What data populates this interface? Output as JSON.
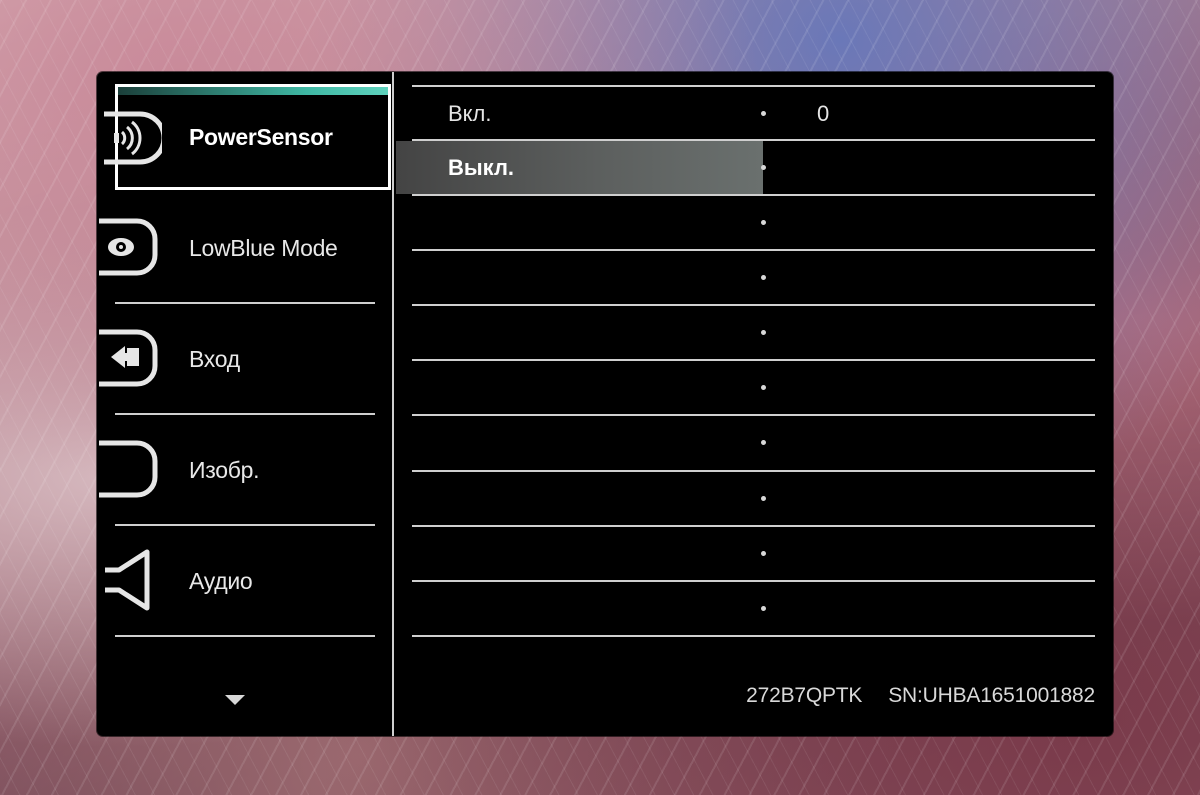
{
  "sidebar": {
    "items": [
      {
        "label": "PowerSensor",
        "icon": "power-sensor-icon",
        "selected": true
      },
      {
        "label": "LowBlue Mode",
        "icon": "eye-icon",
        "selected": false
      },
      {
        "label": "Вход",
        "icon": "input-icon",
        "selected": false
      },
      {
        "label": "Изобр.",
        "icon": "picture-icon",
        "selected": false
      },
      {
        "label": "Аудио",
        "icon": "speaker-icon",
        "selected": false
      }
    ],
    "more_icon": "chevron-down-icon"
  },
  "options": {
    "rows": [
      {
        "label": "Вкл.",
        "value": "0",
        "selected": false
      },
      {
        "label": "Выкл.",
        "value": "",
        "selected": true
      },
      {
        "label": "",
        "value": ""
      },
      {
        "label": "",
        "value": ""
      },
      {
        "label": "",
        "value": ""
      },
      {
        "label": "",
        "value": ""
      },
      {
        "label": "",
        "value": ""
      },
      {
        "label": "",
        "value": ""
      },
      {
        "label": "",
        "value": ""
      },
      {
        "label": "",
        "value": ""
      }
    ]
  },
  "footer": {
    "model": "272B7QPTK",
    "serial": "SN:UHBA1651001882"
  },
  "colors": {
    "accent": "#3fb8a4",
    "menu_background": "#000000",
    "highlight": "#5c5f5e"
  }
}
